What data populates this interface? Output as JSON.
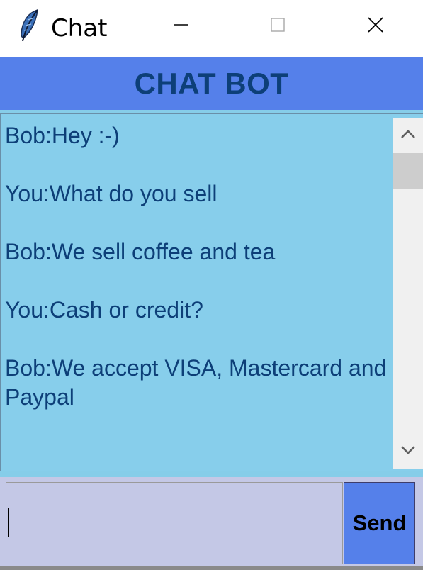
{
  "window": {
    "title": "Chat",
    "icon": "feather-icon",
    "controls": {
      "minimize_icon": "minimize-icon",
      "maximize_icon": "maximize-icon",
      "close_icon": "close-icon"
    }
  },
  "header": {
    "title": "CHAT BOT",
    "background": "#5580ea",
    "text_color": "#0d3f78"
  },
  "chat": {
    "background": "#87ceeb",
    "text_color": "#0d3f78",
    "messages": [
      {
        "text": "Bob:Hey :-)"
      },
      {
        "text": "You:What do you sell"
      },
      {
        "text": "Bob:We sell coffee and tea"
      },
      {
        "text": "You:Cash or credit?"
      },
      {
        "text": "Bob:We accept VISA, Mastercard and Paypal"
      }
    ]
  },
  "composer": {
    "input_value": "",
    "input_background": "#c4c8e6",
    "send_label": "Send",
    "send_background": "#5580ea"
  }
}
